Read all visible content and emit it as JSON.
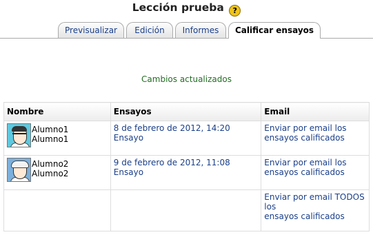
{
  "page": {
    "title": "Lección prueba",
    "help_icon": "?"
  },
  "tabs": [
    {
      "label": "Previsualizar",
      "active": false
    },
    {
      "label": "Edición",
      "active": false
    },
    {
      "label": "Informes",
      "active": false
    },
    {
      "label": "Calificar ensayos",
      "active": true
    }
  ],
  "message": "Cambios actualizados",
  "table": {
    "headers": [
      "Nombre",
      "Ensayos",
      "Email"
    ],
    "rows": [
      {
        "name": "Alumno1 Alumno1",
        "avatar": "avatar-glasses",
        "essay": "8 de febrero de 2012, 14:20 Ensayo",
        "essay_color": "#b0232e",
        "email": "Enviar por email los ensayos calificados"
      },
      {
        "name": "Alumno2 Alumno2",
        "avatar": "avatar-gray-hair",
        "essay": "9 de febrero de 2012, 11:08 Ensayo",
        "essay_color": "#246d25",
        "email": "Enviar por email los ensayos calificados"
      }
    ],
    "footer_email_line1": "Enviar por email TODOS",
    "footer_email_line2": "los",
    "footer_email_line3": "ensayos calificados"
  }
}
